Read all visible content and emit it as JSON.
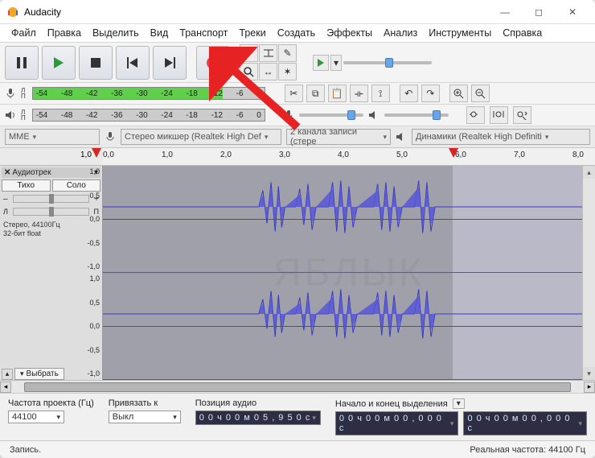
{
  "title": "Audacity",
  "menus": [
    "Файл",
    "Правка",
    "Выделить",
    "Вид",
    "Транспорт",
    "Треки",
    "Создать",
    "Эффекты",
    "Анализ",
    "Инструменты",
    "Справка"
  ],
  "transport": {
    "pause": "pause",
    "play": "play",
    "stop": "stop",
    "skip_start": "skip-start",
    "skip_end": "skip-end",
    "record": "record"
  },
  "meter_ticks": [
    "-54",
    "-48",
    "-42",
    "-36",
    "-30",
    "-24",
    "-18",
    "-12",
    "-6",
    "0"
  ],
  "LR": {
    "L": "Л",
    "R": "П"
  },
  "devices": {
    "host_label": "MME",
    "input_label": "Стерео микшер (Realtek High Def",
    "channels_label": "2 канала записи (стере",
    "output_label": "Динамики (Realtek High Definiti"
  },
  "ruler_ticks": [
    "1,0",
    "0,0",
    "1,0",
    "2,0",
    "3,0",
    "4,0",
    "5,0",
    "6,0",
    "7,0",
    "8,0"
  ],
  "track": {
    "name": "Аудиотрек",
    "mute": "Тихо",
    "solo": "Соло",
    "info1": "Стерео, 44100Гц",
    "info2": "32-бит float",
    "select_btn": "Выбрать"
  },
  "y_labels": [
    "1,0",
    "0,5",
    "0,0",
    "-0,5",
    "-1,0"
  ],
  "bottom": {
    "project_rate_label": "Частота проекта (Гц)",
    "project_rate_value": "44100",
    "snap_label": "Привязать к",
    "snap_value": "Выкл",
    "audio_pos_label": "Позиция аудио",
    "audio_pos_value": "0 0 ч 0 0 м 0 5 , 9 5 0 с",
    "selection_label": "Начало и конец выделения",
    "selection_start": "0 0 ч 0 0 м 0 0 , 0 0 0 с",
    "selection_end": "0 0 ч 0 0 м 0 0 , 0 0 0 с"
  },
  "status": {
    "left": "Запись.",
    "right": "Реальная частота: 44100 Гц"
  },
  "watermark": "ЯБЛЫК"
}
